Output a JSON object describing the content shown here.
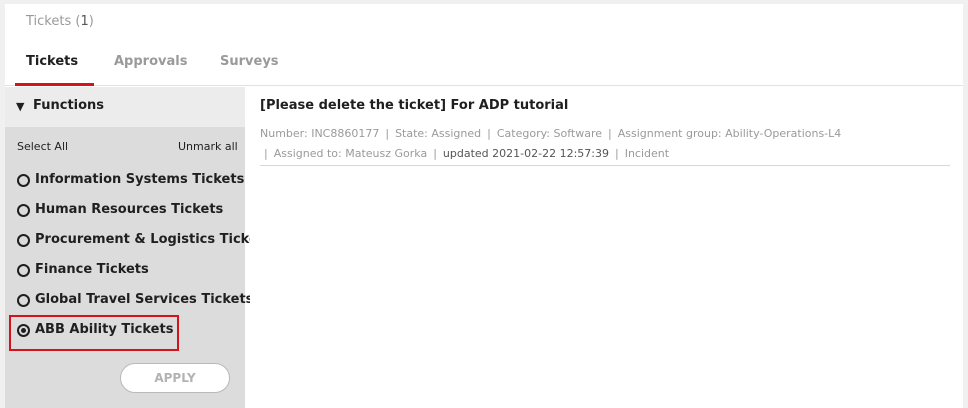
{
  "header": {
    "title": "Tickets",
    "count": "1"
  },
  "tabs": [
    {
      "label": "Tickets",
      "active": true
    },
    {
      "label": "Approvals",
      "active": false
    },
    {
      "label": "Surveys",
      "active": false
    }
  ],
  "sidebar": {
    "heading": "Functions",
    "select_all": "Select All",
    "unmark_all": "Unmark all",
    "options": [
      {
        "label": "Information Systems Tickets",
        "checked": false
      },
      {
        "label": "Human Resources Tickets",
        "checked": false
      },
      {
        "label": "Procurement & Logistics Tickets",
        "checked": false
      },
      {
        "label": "Finance Tickets",
        "checked": false
      },
      {
        "label": "Global Travel Services Tickets",
        "checked": false
      },
      {
        "label": "ABB Ability Tickets",
        "checked": true
      }
    ],
    "apply_label": "APPLY"
  },
  "ticket": {
    "title": "[Please delete the ticket] For ADP tutorial",
    "number": "Number: INC8860177",
    "state": "State: Assigned",
    "category": "Category: Software",
    "assignment_group": "Assignment group: Ability-Operations-L4",
    "assigned_to": "Assigned to: Mateusz Gorka",
    "updated": "updated 2021-02-22 12:57:39",
    "type": "Incident"
  },
  "colors": {
    "accent": "#d4141c",
    "sidebar_bg": "#dcdcdc",
    "muted_text": "#9a9a9a"
  }
}
